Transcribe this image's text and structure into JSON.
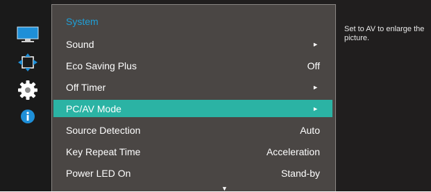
{
  "sidebar": {
    "icons": [
      {
        "name": "picture-icon",
        "active": false
      },
      {
        "name": "position-icon",
        "active": false
      },
      {
        "name": "gear-icon",
        "active": true
      },
      {
        "name": "info-icon",
        "active": false
      }
    ]
  },
  "menu": {
    "title": "System",
    "items": [
      {
        "label": "Sound",
        "value": "",
        "arrow": "►",
        "selected": false
      },
      {
        "label": "Eco Saving Plus",
        "value": "Off",
        "arrow": "",
        "selected": false
      },
      {
        "label": "Off Timer",
        "value": "",
        "arrow": "►",
        "selected": false
      },
      {
        "label": "PC/AV Mode",
        "value": "",
        "arrow": "►",
        "selected": true
      },
      {
        "label": "Source Detection",
        "value": "Auto",
        "arrow": "",
        "selected": false
      },
      {
        "label": "Key Repeat Time",
        "value": "Acceleration",
        "arrow": "",
        "selected": false
      },
      {
        "label": "Power LED On",
        "value": "Stand-by",
        "arrow": "",
        "selected": false
      }
    ],
    "scroll_indicator": "▼"
  },
  "help": {
    "text": "Set to AV to enlarge the picture."
  },
  "colors": {
    "title": "#1fa0d8",
    "selected_bg": "#2bb3a4",
    "panel_bg": "#4a4644",
    "icon_blue": "#1e8fd8"
  }
}
